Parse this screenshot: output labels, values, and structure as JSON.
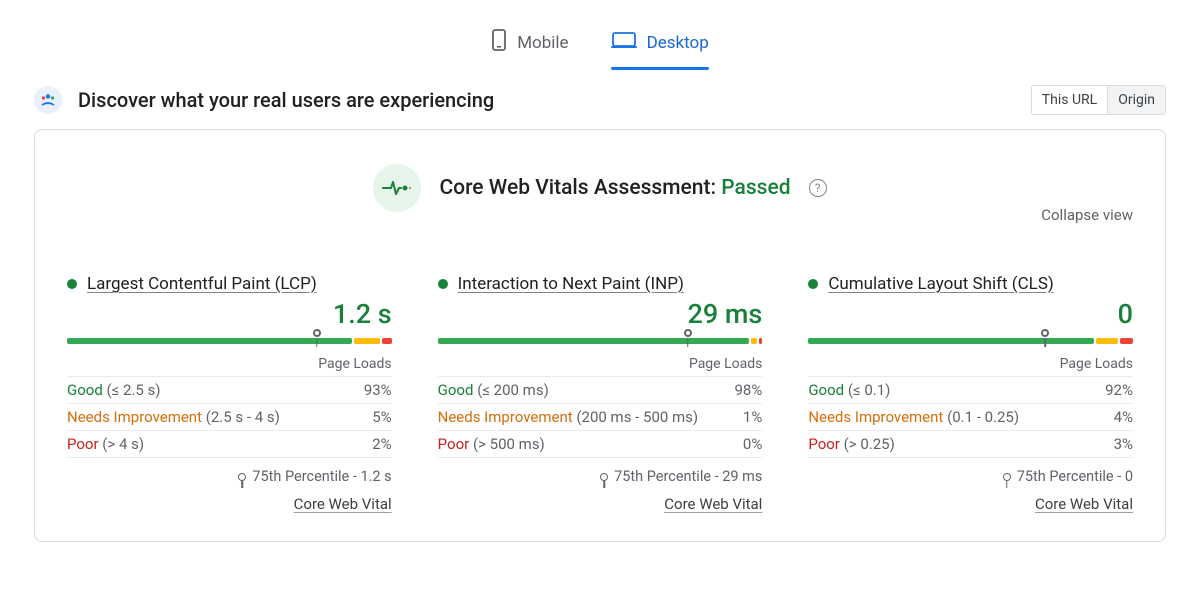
{
  "tabs": {
    "mobile_label": "Mobile",
    "desktop_label": "Desktop"
  },
  "header": {
    "title": "Discover what your real users are experiencing",
    "scope_this_url": "This URL",
    "scope_origin": "Origin"
  },
  "assessment": {
    "label": "Core Web Vitals Assessment:",
    "status": "Passed"
  },
  "collapse_label": "Collapse view",
  "page_loads_label": "Page Loads",
  "core_web_vital_label": "Core Web Vital",
  "percentile_prefix": "75th Percentile - ",
  "metrics": [
    {
      "name": "Largest Contentful Paint (LCP)",
      "value": "1.2 s",
      "good_threshold": "(≤ 2.5 s)",
      "ni_threshold": "(2.5 s - 4 s)",
      "poor_threshold": "(> 4 s)",
      "good_pct": "93%",
      "ni_pct": "5%",
      "poor_pct": "2%",
      "percentile_value": "1.2 s",
      "marker_left": "77%",
      "good_w": 89,
      "ni_w": 8,
      "poor_w": 3
    },
    {
      "name": "Interaction to Next Paint (INP)",
      "value": "29 ms",
      "good_threshold": "(≤ 200 ms)",
      "ni_threshold": "(200 ms - 500 ms)",
      "poor_threshold": "(> 500 ms)",
      "good_pct": "98%",
      "ni_pct": "1%",
      "poor_pct": "0%",
      "percentile_value": "29 ms",
      "marker_left": "77%",
      "good_w": 97,
      "ni_w": 2,
      "poor_w": 1
    },
    {
      "name": "Cumulative Layout Shift (CLS)",
      "value": "0",
      "good_threshold": "(≤ 0.1)",
      "ni_threshold": "(0.1 - 0.25)",
      "poor_threshold": "(> 0.25)",
      "good_pct": "92%",
      "ni_pct": "4%",
      "poor_pct": "3%",
      "percentile_value": "0",
      "marker_left": "73%",
      "good_w": 89,
      "ni_w": 7,
      "poor_w": 4
    }
  ],
  "dist_labels": {
    "good": "Good",
    "ni": "Needs Improvement",
    "poor": "Poor"
  }
}
